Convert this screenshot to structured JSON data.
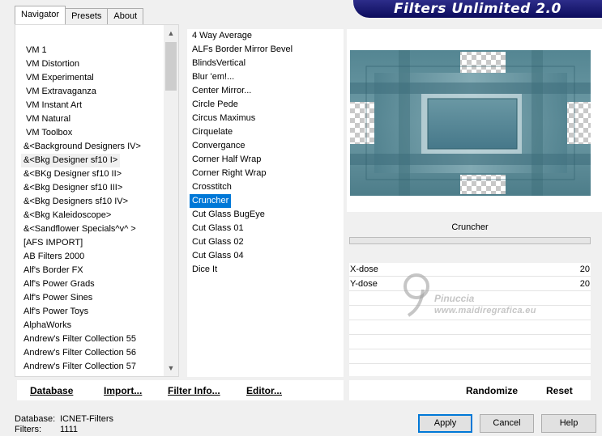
{
  "banner": {
    "title": "Filters Unlimited 2.0"
  },
  "tabs": [
    {
      "label": "Navigator",
      "active": true
    },
    {
      "label": "Presets",
      "active": false
    },
    {
      "label": "About",
      "active": false
    }
  ],
  "categories": [
    {
      "label": "VM 1"
    },
    {
      "label": "VM Distortion"
    },
    {
      "label": "VM Experimental"
    },
    {
      "label": "VM Extravaganza"
    },
    {
      "label": "VM Instant Art"
    },
    {
      "label": "VM Natural"
    },
    {
      "label": "VM Toolbox"
    },
    {
      "label": "&<Background Designers IV>"
    },
    {
      "label": "&<Bkg Designer sf10 I>",
      "selected": true
    },
    {
      "label": "&<BKg Designer sf10 II>"
    },
    {
      "label": "&<Bkg Designer sf10 III>"
    },
    {
      "label": "&<Bkg Designers sf10 IV>"
    },
    {
      "label": "&<Bkg Kaleidoscope>"
    },
    {
      "label": "&<Sandflower Specials^v^ >"
    },
    {
      "label": "[AFS IMPORT]"
    },
    {
      "label": "AB Filters 2000"
    },
    {
      "label": "Alf's Border FX"
    },
    {
      "label": "Alf's Power Grads"
    },
    {
      "label": "Alf's Power Sines"
    },
    {
      "label": "Alf's Power Toys"
    },
    {
      "label": "AlphaWorks"
    },
    {
      "label": "Andrew's Filter Collection 55"
    },
    {
      "label": "Andrew's Filter Collection 56"
    },
    {
      "label": "Andrew's Filter Collection 57"
    }
  ],
  "filters": [
    {
      "label": "4 Way Average"
    },
    {
      "label": "ALFs Border Mirror Bevel"
    },
    {
      "label": "BlindsVertical"
    },
    {
      "label": "Blur 'em!..."
    },
    {
      "label": "Center Mirror..."
    },
    {
      "label": "Circle Pede"
    },
    {
      "label": "Circus Maximus"
    },
    {
      "label": "Cirquelate"
    },
    {
      "label": "Convergance"
    },
    {
      "label": "Corner Half Wrap"
    },
    {
      "label": "Corner Right Wrap"
    },
    {
      "label": "Crosstitch"
    },
    {
      "label": "Cruncher",
      "selected": true
    },
    {
      "label": "Cut Glass  BugEye"
    },
    {
      "label": "Cut Glass 01"
    },
    {
      "label": "Cut Glass 02"
    },
    {
      "label": "Cut Glass 04"
    },
    {
      "label": "Dice It"
    }
  ],
  "scroll": {
    "up_icon": "▲",
    "down_icon": "▼"
  },
  "filter_name": "Cruncher",
  "params": [
    {
      "label": "X-dose",
      "value": "20"
    },
    {
      "label": "Y-dose",
      "value": "20"
    }
  ],
  "watermark": {
    "name": "Pinuccia",
    "url": "www.maidiregrafica.eu"
  },
  "left_buttons": {
    "database": "Database",
    "import": "Import...",
    "filter_info": "Filter Info...",
    "editor": "Editor..."
  },
  "right_buttons": {
    "randomize": "Randomize",
    "reset": "Reset"
  },
  "footer": {
    "database_label": "Database:",
    "database_value": "ICNET-Filters",
    "filters_label": "Filters:",
    "filters_value": "1111",
    "apply": "Apply",
    "cancel": "Cancel",
    "help": "Help"
  },
  "colors": {
    "banner": "#14146e",
    "selection": "#0078d7",
    "preview_teal": "#5e8e9a"
  }
}
